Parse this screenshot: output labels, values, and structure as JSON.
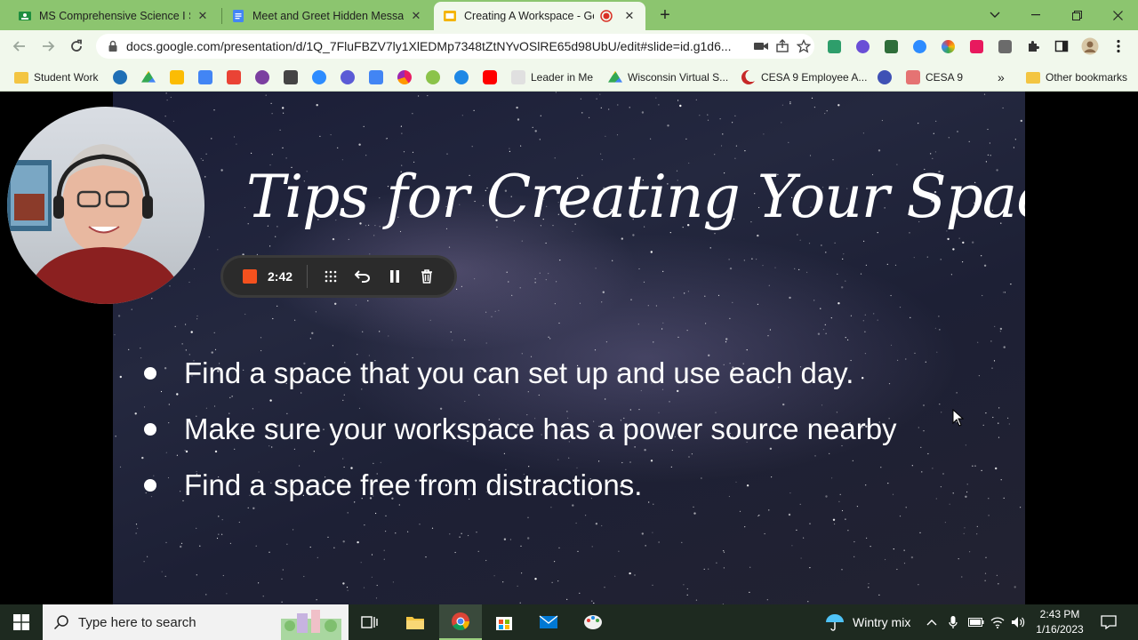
{
  "browser": {
    "tabs": [
      {
        "title": "MS Comprehensive Science I S2",
        "icon": "classroom-icon",
        "active": false
      },
      {
        "title": "Meet and Greet Hidden Message",
        "icon": "docs-icon",
        "active": false
      },
      {
        "title": "Creating A Workspace - Goo",
        "icon": "slides-icon",
        "active": true
      }
    ],
    "new_tab": "+",
    "url": "docs.google.com/presentation/d/1Q_7FluFBZV7ly1XlEDMp7348tZtNYvOSlRE65d98UbU/edit#slide=id.g1d6...",
    "bookmarks": [
      {
        "label": "Student Work",
        "type": "folder"
      },
      {
        "label": "",
        "icon": "schoology-icon",
        "color": "#1f6fb5"
      },
      {
        "label": "",
        "icon": "drive-icon",
        "color": "#34a853"
      },
      {
        "label": "",
        "icon": "keep-icon",
        "color": "#fbbc04"
      },
      {
        "label": "",
        "icon": "calendar-icon",
        "color": "#4285f4"
      },
      {
        "label": "",
        "icon": "gmail-icon",
        "color": "#ea4335"
      },
      {
        "label": "",
        "icon": "bulb-icon",
        "color": "#7b3fa0"
      },
      {
        "label": "",
        "icon": "car-icon",
        "color": "#444444"
      },
      {
        "label": "",
        "icon": "zoom-icon",
        "color": "#2d8cff"
      },
      {
        "label": "",
        "icon": "asterisk-icon",
        "color": "#5b5bd6"
      },
      {
        "label": "",
        "icon": "calendar31-icon",
        "color": "#4285f4"
      },
      {
        "label": "",
        "icon": "pie-icon",
        "color": "#e91e63"
      },
      {
        "label": "",
        "icon": "acorn-icon",
        "color": "#8bc34a"
      },
      {
        "label": "",
        "icon": "safari-icon",
        "color": "#1e88e5"
      },
      {
        "label": "",
        "icon": "youtube-icon",
        "color": "#ff0000"
      },
      {
        "label": "Leader in Me",
        "icon": "lim-icon",
        "color": "#e0e0e0"
      },
      {
        "label": "Wisconsin Virtual S...",
        "icon": "drive-icon",
        "color": "#34a853"
      },
      {
        "label": "CESA 9 Employee A...",
        "icon": "moon-icon",
        "color": "#c62828"
      },
      {
        "label": "",
        "icon": "infinity-icon",
        "color": "#3f51b5"
      },
      {
        "label": "CESA 9",
        "icon": "cesa-icon",
        "color": "#e57373"
      }
    ],
    "more_bookmarks": "»",
    "other_bookmarks": "Other bookmarks"
  },
  "slide": {
    "title": "Tips for Creating Your Space",
    "bullets": [
      "Find a space that you can set up and use each day.",
      "Make sure your workspace has a power source nearby",
      "Find a space free from distractions."
    ]
  },
  "recorder": {
    "time": "2:42",
    "stop_color": "#f4511e"
  },
  "taskbar": {
    "search_placeholder": "Type here to search",
    "weather": "Wintry mix",
    "time": "2:43 PM",
    "date": "1/16/2023"
  },
  "colors": {
    "chrome_frame": "#8cc56f",
    "toolbar": "#f1f8ec"
  }
}
